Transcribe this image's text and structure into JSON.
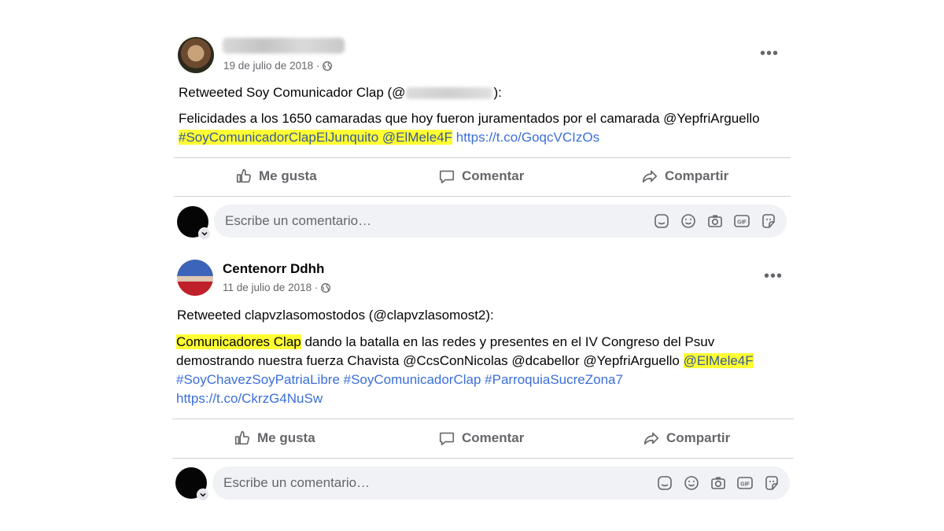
{
  "posts": [
    {
      "author": "",
      "date": "19 de julio de 2018 ·",
      "retweet_prefix": "Retweeted Soy Comunicador Clap (@",
      "retweet_suffix": "):",
      "body_plain": "Felicidades a los 1650 camaradas que hoy fueron juramentados por el camarada @YepfriArguello",
      "highlight": "#SoyComunicadorClapElJunquito @ElMele4F",
      "link": "https://t.co/GoqcVCIzOs"
    },
    {
      "author": "Centenorr Ddhh",
      "date": "11 de julio de 2018 ·",
      "retweet_line": "Retweeted clapvzlasomostodos (@clapvzlasomost2):",
      "highlight_start": "Comunicadores Clap",
      "body_plain_1": " dando la batalla en las redes y presentes en el IV Congreso del Psuv",
      "body_plain_2": "demostrando nuestra fuerza Chavista @CcsConNicolas @dcabellor @YepfriArguello",
      "highlight_end": "@ElMele4F",
      "hashtags": "#SoyChavezSoyPatriaLibre #SoyComunicadorClap #ParroquiaSucreZona7",
      "link": "https://t.co/CkrzG4NuSw"
    }
  ],
  "actions": {
    "like": "Me gusta",
    "comment": "Comentar",
    "share": "Compartir"
  },
  "comment_placeholder": "Escribe un comentario…",
  "icons": [
    "globe-icon",
    "more-icon",
    "like-icon",
    "comment-icon",
    "share-icon",
    "sticker-icon",
    "emoji-icon",
    "camera-icon",
    "gif-icon",
    "sticker-face-icon"
  ]
}
